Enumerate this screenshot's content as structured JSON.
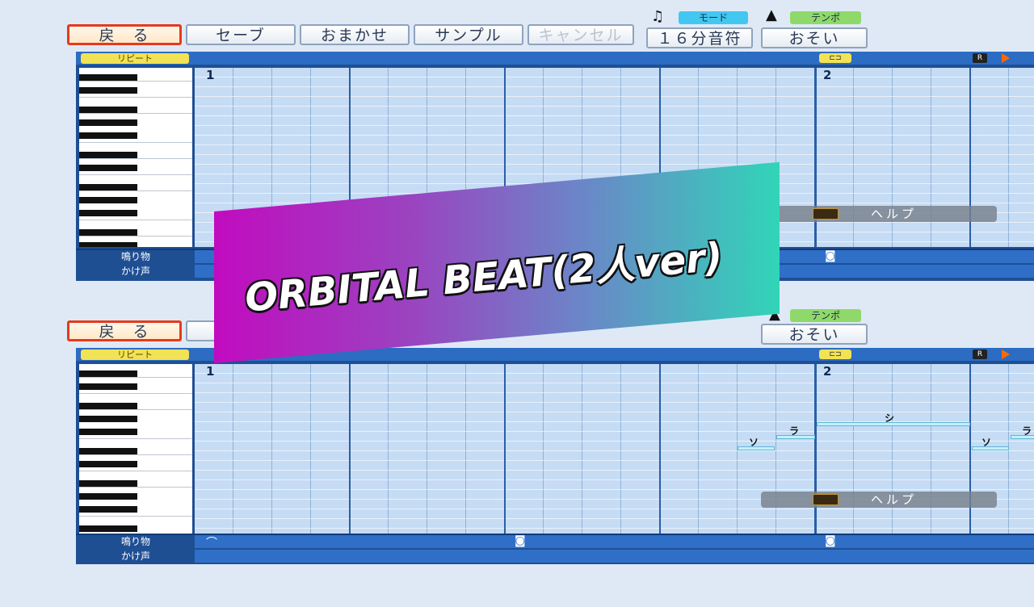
{
  "toolbar": {
    "back": "戻　る",
    "save": "セーブ",
    "omakase": "おまかせ",
    "sample": "サンプル",
    "cancel": "キャンセル",
    "note_value": "１６分音符",
    "tempo_value": "おそい"
  },
  "tags": {
    "mode": "モード",
    "tempo": "テンポ"
  },
  "roll": {
    "repeat_label": "リピート",
    "lane_sounds": "鳴り物",
    "lane_calls": "かけ声",
    "bar1": "1",
    "bar2": "2"
  },
  "help": {
    "label": "ヘルプ"
  },
  "banner": {
    "title": "ORBITAL BEAT(2人ver)"
  },
  "notes": {
    "lyric_so": "ソ",
    "lyric_ra": "ラ",
    "lyric_shi": "シ"
  },
  "badges": {
    "r": "R"
  },
  "colors": {
    "accent_back": "#e53a1c",
    "mode_tag": "#42c7f0",
    "tempo_tag": "#8fd96a",
    "banner_start": "#c10bbf",
    "banner_end": "#31d5b8"
  },
  "icons": [
    "music-note-icon",
    "metronome-icon",
    "drum-icon",
    "play-icon",
    "help-icon"
  ]
}
